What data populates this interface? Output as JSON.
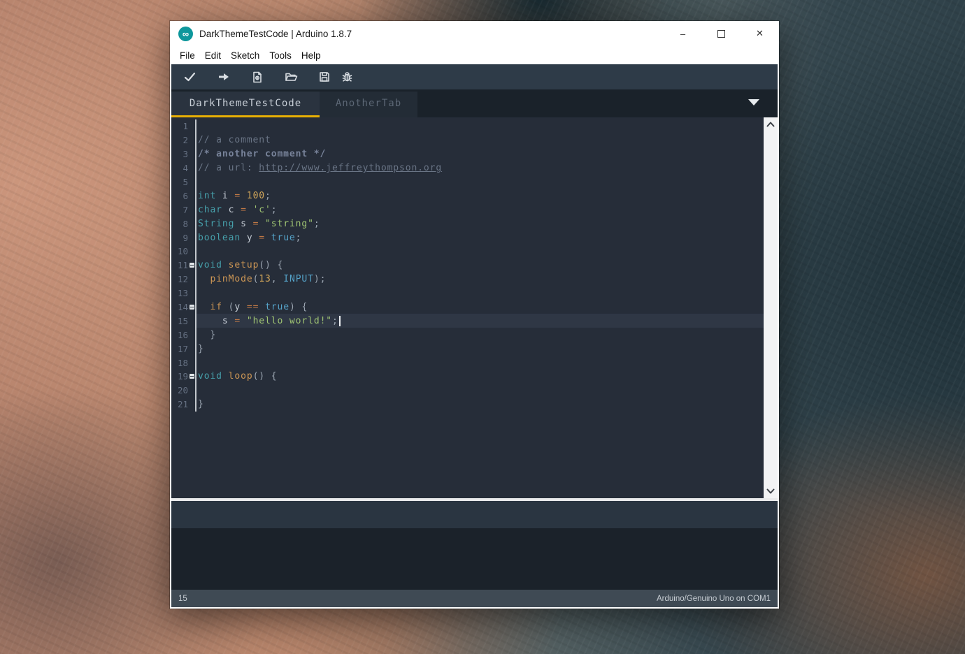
{
  "window": {
    "title": "DarkThemeTestCode | Arduino 1.8.7",
    "logo_glyph": "∞",
    "controls": {
      "minimize": "–",
      "close": "✕"
    }
  },
  "menu": {
    "items": [
      "File",
      "Edit",
      "Sketch",
      "Tools",
      "Help"
    ]
  },
  "toolbar": {
    "buttons": [
      "verify",
      "upload",
      "new-sketch",
      "open",
      "save",
      "serial-debug"
    ]
  },
  "tabs": {
    "items": [
      {
        "label": "DarkThemeTestCode",
        "active": true
      },
      {
        "label": "AnotherTab",
        "active": false
      }
    ]
  },
  "colors": {
    "comment": "#6a7586",
    "keyword": "#47a1ac",
    "function": "#ce9755",
    "operator": "#be7846",
    "number": "#d3a75a",
    "string": "#a0c573",
    "literal": "#55a3c9",
    "plain": "#c4cbd4",
    "punctuation": "#9aa4b0",
    "accent_underline": "#e8b004",
    "editor_bg": "#262d39",
    "toolbar_bg": "#2e3b48"
  },
  "editor": {
    "lines": [
      {
        "num": "1",
        "seg": []
      },
      {
        "num": "2",
        "seg": [
          {
            "t": "// a comment",
            "c": "cm"
          }
        ]
      },
      {
        "num": "3",
        "seg": [
          {
            "t": "/* another comment */",
            "c": "cmb"
          }
        ]
      },
      {
        "num": "4",
        "seg": [
          {
            "t": "// a url: ",
            "c": "cm"
          },
          {
            "t": "http://www.jeffreythompson.org",
            "c": "url"
          }
        ]
      },
      {
        "num": "5",
        "seg": []
      },
      {
        "num": "6",
        "seg": [
          {
            "t": "int",
            "c": "kw"
          },
          {
            "t": " i ",
            "c": "pl"
          },
          {
            "t": "=",
            "c": "op"
          },
          {
            "t": " ",
            "c": "pl"
          },
          {
            "t": "100",
            "c": "num"
          },
          {
            "t": ";",
            "c": "pun"
          }
        ]
      },
      {
        "num": "7",
        "seg": [
          {
            "t": "char",
            "c": "kw"
          },
          {
            "t": " c ",
            "c": "pl"
          },
          {
            "t": "=",
            "c": "op"
          },
          {
            "t": " ",
            "c": "pl"
          },
          {
            "t": "'c'",
            "c": "str"
          },
          {
            "t": ";",
            "c": "pun"
          }
        ]
      },
      {
        "num": "8",
        "seg": [
          {
            "t": "String",
            "c": "kw"
          },
          {
            "t": " s ",
            "c": "pl"
          },
          {
            "t": "=",
            "c": "op"
          },
          {
            "t": " ",
            "c": "pl"
          },
          {
            "t": "\"string\"",
            "c": "str"
          },
          {
            "t": ";",
            "c": "pun"
          }
        ]
      },
      {
        "num": "9",
        "seg": [
          {
            "t": "boolean",
            "c": "kw"
          },
          {
            "t": " y ",
            "c": "pl"
          },
          {
            "t": "=",
            "c": "op"
          },
          {
            "t": " ",
            "c": "pl"
          },
          {
            "t": "true",
            "c": "lit"
          },
          {
            "t": ";",
            "c": "pun"
          }
        ]
      },
      {
        "num": "10",
        "seg": []
      },
      {
        "num": "11",
        "fold": true,
        "seg": [
          {
            "t": "void",
            "c": "kw"
          },
          {
            "t": " ",
            "c": "pl"
          },
          {
            "t": "setup",
            "c": "fn"
          },
          {
            "t": "() {",
            "c": "pun"
          }
        ]
      },
      {
        "num": "12",
        "seg": [
          {
            "t": "  ",
            "c": "pl"
          },
          {
            "t": "pinMode",
            "c": "fn"
          },
          {
            "t": "(",
            "c": "pun"
          },
          {
            "t": "13",
            "c": "num"
          },
          {
            "t": ", ",
            "c": "pun"
          },
          {
            "t": "INPUT",
            "c": "lit"
          },
          {
            "t": ");",
            "c": "pun"
          }
        ]
      },
      {
        "num": "13",
        "seg": []
      },
      {
        "num": "14",
        "fold": true,
        "seg": [
          {
            "t": "  ",
            "c": "pl"
          },
          {
            "t": "if",
            "c": "fn"
          },
          {
            "t": " (",
            "c": "pun"
          },
          {
            "t": "y ",
            "c": "pl"
          },
          {
            "t": "==",
            "c": "op"
          },
          {
            "t": " ",
            "c": "pl"
          },
          {
            "t": "true",
            "c": "lit"
          },
          {
            "t": ") {",
            "c": "pun"
          }
        ]
      },
      {
        "num": "15",
        "current": true,
        "caret": true,
        "seg": [
          {
            "t": "    s ",
            "c": "pl"
          },
          {
            "t": "=",
            "c": "op"
          },
          {
            "t": " ",
            "c": "pl"
          },
          {
            "t": "\"hello world!\"",
            "c": "str"
          },
          {
            "t": ";",
            "c": "pun"
          }
        ]
      },
      {
        "num": "16",
        "seg": [
          {
            "t": "  }",
            "c": "pun"
          }
        ]
      },
      {
        "num": "17",
        "seg": [
          {
            "t": "}",
            "c": "pun"
          }
        ]
      },
      {
        "num": "18",
        "seg": []
      },
      {
        "num": "19",
        "fold": true,
        "seg": [
          {
            "t": "void",
            "c": "kw"
          },
          {
            "t": " ",
            "c": "pl"
          },
          {
            "t": "loop",
            "c": "fn"
          },
          {
            "t": "() {",
            "c": "pun"
          }
        ]
      },
      {
        "num": "20",
        "seg": []
      },
      {
        "num": "21",
        "seg": [
          {
            "t": "}",
            "c": "pun"
          }
        ]
      }
    ]
  },
  "status_bar": {
    "left": "15",
    "right": "Arduino/Genuino Uno on COM1"
  }
}
